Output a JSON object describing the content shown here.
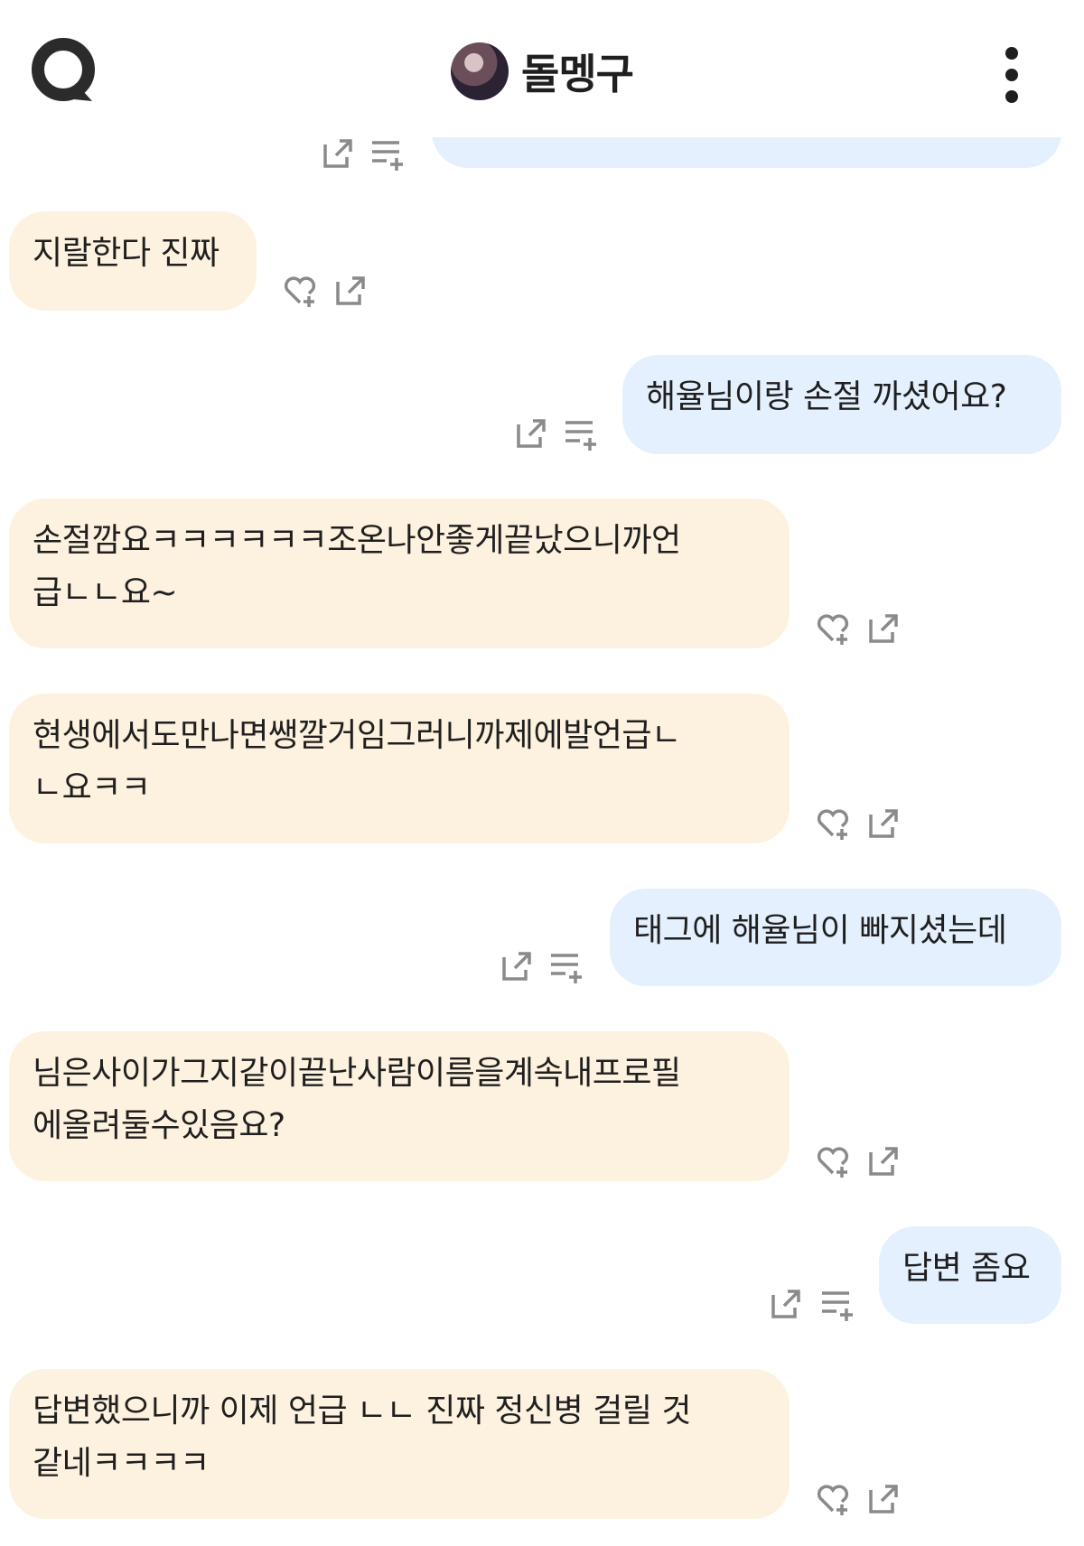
{
  "header": {
    "title": "돌멩구",
    "search_icon": "search-icon",
    "more_icon": "more-vertical-icon"
  },
  "messages": [
    {
      "sender": "mine",
      "text": ""
    },
    {
      "sender": "other",
      "text": "지랄한다 진짜"
    },
    {
      "sender": "mine",
      "text": "해율님이랑 손절 까셨어요?"
    },
    {
      "sender": "other",
      "text": "손절깜요ㅋㅋㅋㅋㅋㅋ조온나안좋게끝났으니까언\n급ㄴㄴ요~"
    },
    {
      "sender": "other",
      "text": "현생에서도만나면쌩깔거임그러니까제에발언급ㄴ\nㄴ요ㅋㅋ"
    },
    {
      "sender": "mine",
      "text": "태그에 해율님이 빠지셨는데"
    },
    {
      "sender": "other",
      "text": "님은사이가그지같이끝난사람이름을계속내프로필\n에올려둘수있음요?"
    },
    {
      "sender": "mine",
      "text": "답변 좀요"
    },
    {
      "sender": "other",
      "text": "답변했으니까 이제 언급 ㄴㄴ 진짜 정신병 걸릴 것\n같네ㅋㅋㅋㅋ"
    }
  ],
  "icons": {
    "other_actions": [
      "heart-plus-icon",
      "share-icon"
    ],
    "mine_actions": [
      "share-icon",
      "playlist-add-icon"
    ]
  },
  "colors": {
    "other_bubble": "#fdf2df",
    "mine_bubble": "#e4f0fd",
    "icon": "#8a8a8a"
  }
}
